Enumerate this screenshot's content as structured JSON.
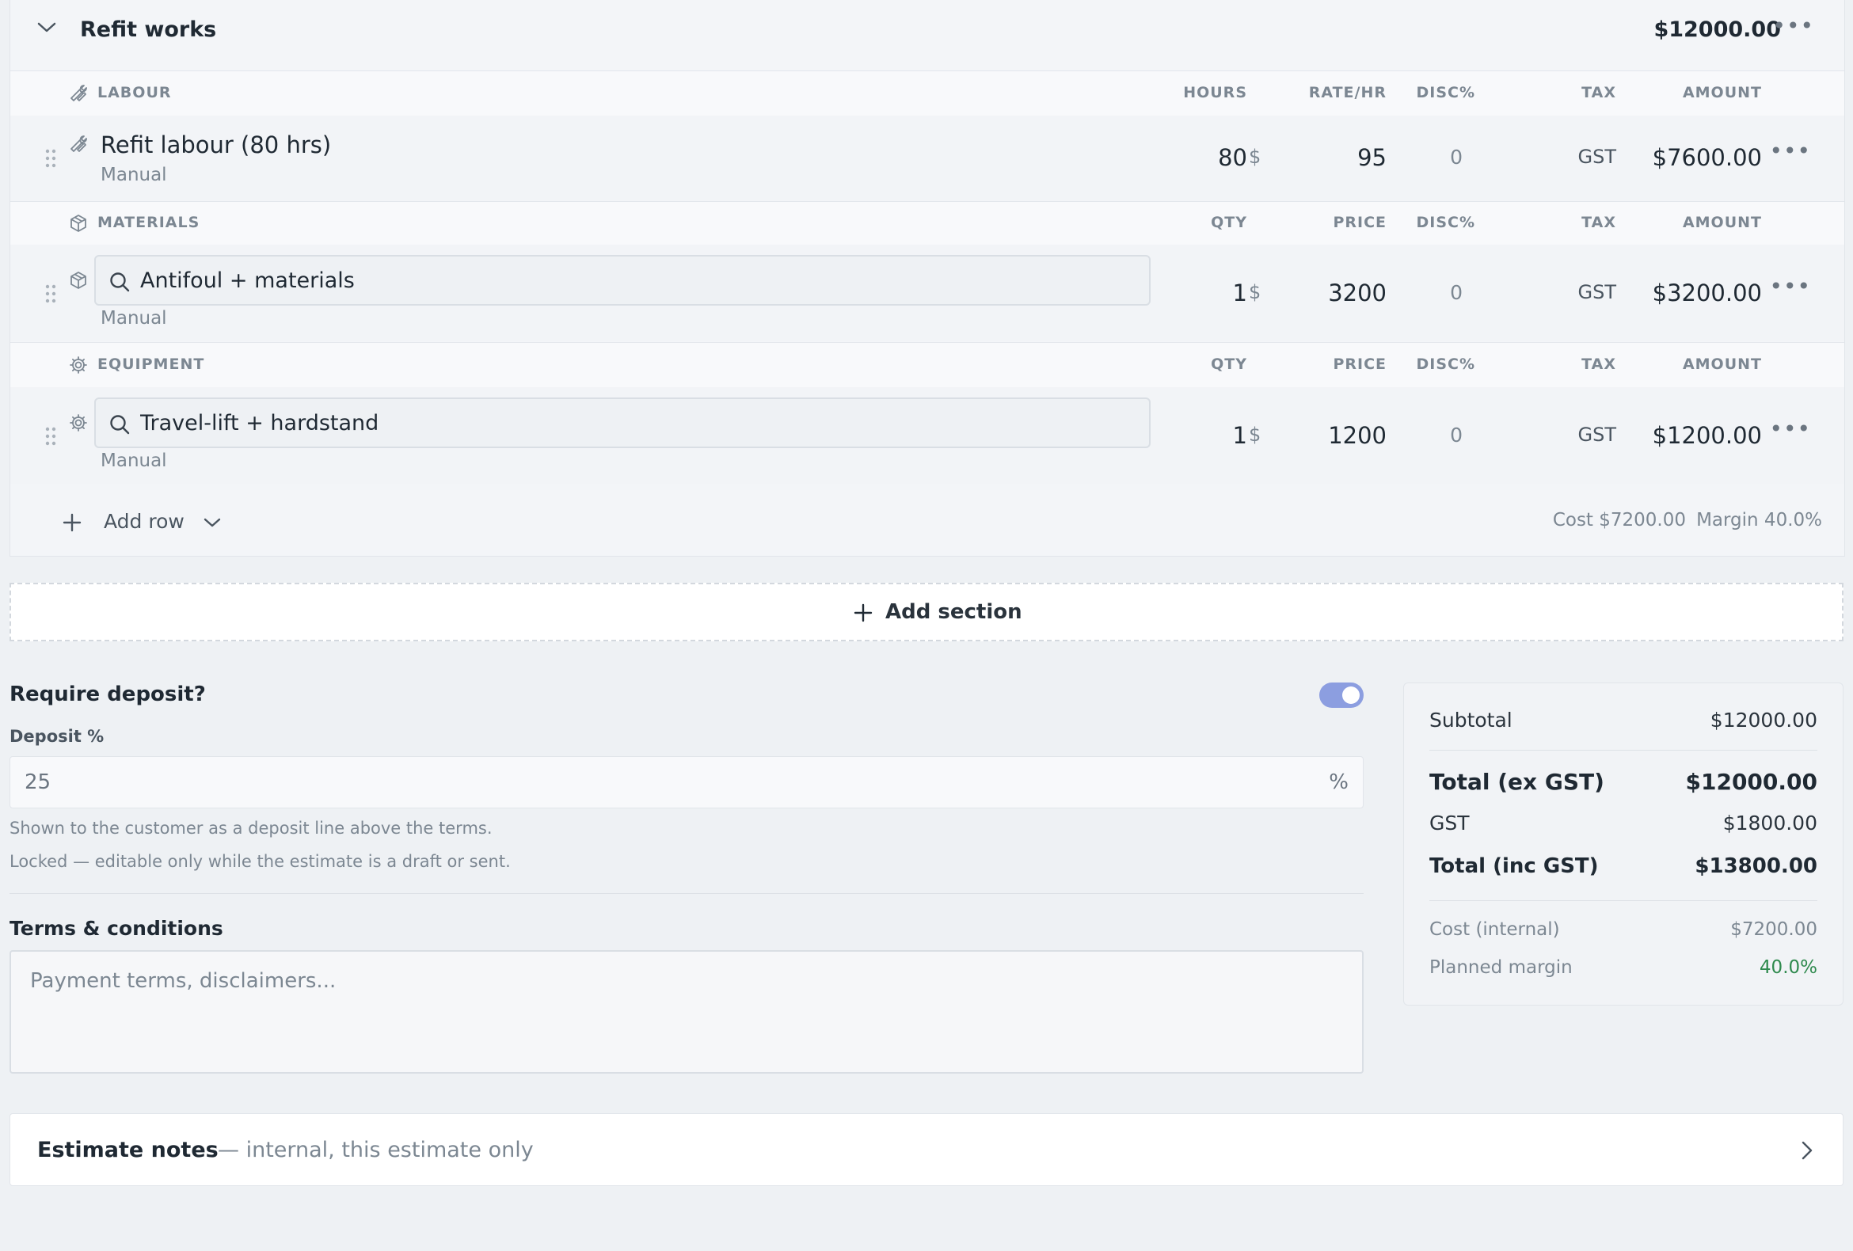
{
  "section": {
    "title": "Refit works",
    "total": "$12000.00"
  },
  "labour": {
    "header": {
      "label": "LABOUR",
      "qty": "HOURS",
      "price": "RATE/HR",
      "disc": "DISC%",
      "tax": "TAX",
      "amount": "AMOUNT"
    },
    "row": {
      "name": "Refit labour (80 hrs)",
      "source": "Manual",
      "qty": "80",
      "currency": "$",
      "price": "95",
      "disc": "0",
      "tax": "GST",
      "amount": "$7600.00"
    }
  },
  "materials": {
    "header": {
      "label": "MATERIALS",
      "qty": "QTY",
      "price": "PRICE",
      "disc": "DISC%",
      "tax": "TAX",
      "amount": "AMOUNT"
    },
    "row": {
      "name": "Antifoul + materials",
      "source": "Manual",
      "qty": "1",
      "currency": "$",
      "price": "3200",
      "disc": "0",
      "tax": "GST",
      "amount": "$3200.00"
    }
  },
  "equipment": {
    "header": {
      "label": "EQUIPMENT",
      "qty": "QTY",
      "price": "PRICE",
      "disc": "DISC%",
      "tax": "TAX",
      "amount": "AMOUNT"
    },
    "row": {
      "name": "Travel-lift + hardstand",
      "source": "Manual",
      "qty": "1",
      "currency": "$",
      "price": "1200",
      "disc": "0",
      "tax": "GST",
      "amount": "$1200.00"
    }
  },
  "footer": {
    "add_row": "Add row",
    "cost": "Cost $7200.00",
    "margin": "Margin 40.0%"
  },
  "add_section": "Add section",
  "deposit": {
    "title": "Require deposit?",
    "enabled": true,
    "label": "Deposit %",
    "value": "25",
    "unit": "%",
    "help1": "Shown to the customer as a deposit line above the terms.",
    "help2": "Locked — editable only while the estimate is a draft or sent."
  },
  "terms": {
    "title": "Terms & conditions",
    "placeholder": "Payment terms, disclaimers..."
  },
  "summary": {
    "subtotal_label": "Subtotal",
    "subtotal": "$12000.00",
    "total_ex_label": "Total (ex GST)",
    "total_ex": "$12000.00",
    "gst_label": "GST",
    "gst": "$1800.00",
    "total_inc_label": "Total (inc GST)",
    "total_inc": "$13800.00",
    "cost_label": "Cost (internal)",
    "cost": "$7200.00",
    "margin_label": "Planned margin",
    "margin": "40.0%"
  },
  "notes": {
    "title": "Estimate notes",
    "subtitle": "— internal, this estimate only"
  },
  "colors": {
    "toggle_on": "#8c9ee0",
    "margin_green": "#2f8a4e",
    "muted": "#7c8792"
  }
}
